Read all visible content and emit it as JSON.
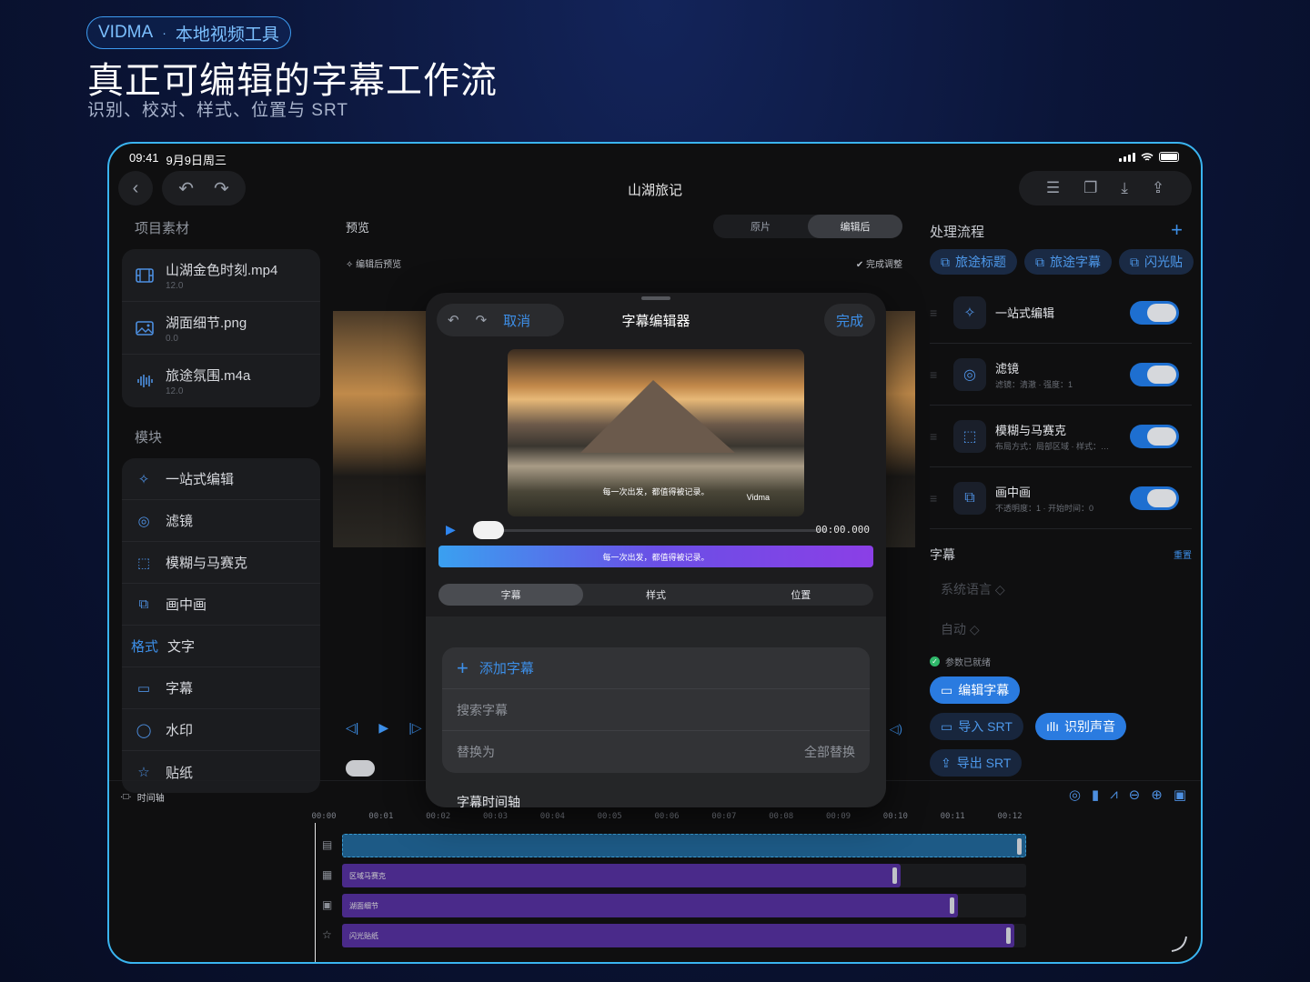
{
  "hero": {
    "brand": "VIDMA",
    "dot": "·",
    "tagline": "本地视频工具",
    "title": "真正可编辑的字幕工作流",
    "subtitle": "识别、校对、样式、位置与 SRT"
  },
  "status": {
    "time": "09:41",
    "date": "9月9日周三"
  },
  "project": {
    "title": "山湖旅记"
  },
  "left": {
    "assets_header": "项目素材",
    "files": [
      {
        "name": "山湖金色时刻.mp4",
        "size": "12.0",
        "icon": "film-icon"
      },
      {
        "name": "湖面细节.png",
        "size": "0.0",
        "icon": "image-icon"
      },
      {
        "name": "旅途氛围.m4a",
        "size": "12.0",
        "icon": "audio-icon"
      }
    ],
    "modules_header": "模块",
    "modules": [
      {
        "label": "一站式编辑",
        "icon": "magic-icon"
      },
      {
        "label": "滤镜",
        "icon": "filter-icon"
      },
      {
        "label": "模糊与马赛克",
        "icon": "blur-icon"
      },
      {
        "label": "画中画",
        "icon": "pip-icon"
      },
      {
        "tag": "格式",
        "label": "文字",
        "icon": ""
      },
      {
        "label": "字幕",
        "icon": "subtitle-icon"
      },
      {
        "label": "水印",
        "icon": "drop-icon"
      },
      {
        "label": "贴纸",
        "icon": "star-icon"
      }
    ]
  },
  "preview": {
    "header": "预览",
    "seg_original": "原片",
    "seg_edited": "编辑后",
    "sub": "编辑后预览",
    "done": "完成调整"
  },
  "right": {
    "header": "处理流程",
    "chips": [
      "旅途标题",
      "旅途字幕",
      "闪光贴"
    ],
    "flows": [
      {
        "name": "一站式编辑",
        "desc": ""
      },
      {
        "name": "滤镜",
        "desc": "滤镜：清澈 · 强度：1"
      },
      {
        "name": "模糊与马赛克",
        "desc": "布局方式：局部区域 · 样式：…"
      },
      {
        "name": "画中画",
        "desc": "不透明度：1 · 开始时间：0"
      }
    ],
    "subtitle_header": "字幕",
    "reset": "重置",
    "lang": "系统语言 ◇",
    "auto": "自动 ◇",
    "ready": "参数已就绪",
    "edit_sub": "编辑字幕",
    "import_srt": "导入 SRT",
    "recognize": "识别声音",
    "export_srt": "导出 SRT"
  },
  "modal": {
    "cancel": "取消",
    "title": "字幕编辑器",
    "done": "完成",
    "caption": "每一次出发，都值得被记录。",
    "watermark": "Vidma",
    "time": "00:00.000",
    "cue": "每一次出发，都值得被记录。",
    "tabs": [
      "字幕",
      "样式",
      "位置"
    ],
    "add": "添加字幕",
    "search_placeholder": "搜索字幕",
    "replace_placeholder": "替换为",
    "replace_all": "全部替换",
    "timeline_header": "字幕时间轴"
  },
  "timeline": {
    "header": "时间轴",
    "ticks": [
      "00:00",
      "00:01",
      "00:02",
      "00:03",
      "00:04",
      "00:05",
      "00:06",
      "00:07",
      "00:08",
      "00:09",
      "00:10",
      "00:11",
      "00:12"
    ],
    "tracks": [
      {
        "label": "",
        "end": 12.0,
        "color": "#1d5a86"
      },
      {
        "label": "区域马赛克",
        "end": 9.8,
        "color": "#4a2a8a"
      },
      {
        "label": "湖面细节",
        "end": 10.8,
        "color": "#4a2a8a"
      },
      {
        "label": "闪光贴纸",
        "end": 11.8,
        "color": "#4a2a8a"
      }
    ]
  }
}
